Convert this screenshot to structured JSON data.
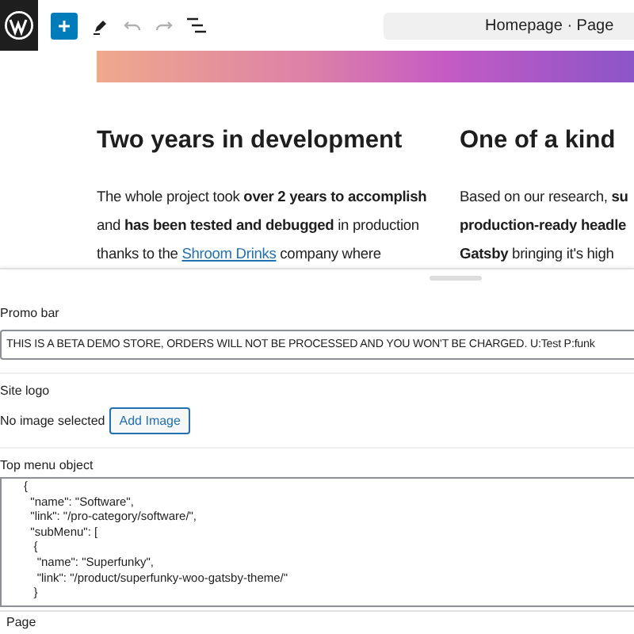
{
  "toolbar": {
    "document_title": "Homepage · Page"
  },
  "content": {
    "columns": [
      {
        "heading": "Two years in development",
        "lines": [
          [
            {
              "kind": "text",
              "text": "The whole project took **over 2 years to accomplish**"
            }
          ],
          [
            {
              "kind": "text",
              "text": "and **has been tested and debugged** in production"
            }
          ],
          [
            {
              "kind": "text",
              "text": "thanks to the "
            },
            {
              "kind": "link",
              "text": "Shroom Drinks"
            },
            {
              "kind": "text",
              "text": " company where"
            }
          ]
        ]
      },
      {
        "heading": "One of a kind",
        "lines": [
          [
            {
              "kind": "text",
              "text": "Based on our research, **su**"
            }
          ],
          [
            {
              "kind": "text",
              "text": "**production-ready headle**"
            }
          ],
          [
            {
              "kind": "text",
              "text": "**Gatsby** bringing it's high"
            }
          ]
        ]
      }
    ]
  },
  "panel": {
    "fields": [
      {
        "kind": "text",
        "label": "Promo bar",
        "value": "THIS IS A BETA DEMO STORE, ORDERS WILL NOT BE PROCESSED AND YOU WON'T BE CHARGED. U:Test P:funk"
      },
      {
        "kind": "image",
        "label": "Site logo",
        "note": "No image selected",
        "button": "Add Image"
      },
      {
        "kind": "code",
        "label": "Top menu object",
        "lines": [
          "{",
          "  \"name\": \"Software\",",
          "  \"link\": \"/pro-category/software/\",",
          "  \"subMenu\": [",
          "   {",
          "    \"name\": \"Superfunky\",",
          "    \"link\": \"/product/superfunky-woo-gatsby-theme/\"",
          "   }"
        ]
      }
    ]
  },
  "footer": {
    "breadcrumb": "Page"
  }
}
